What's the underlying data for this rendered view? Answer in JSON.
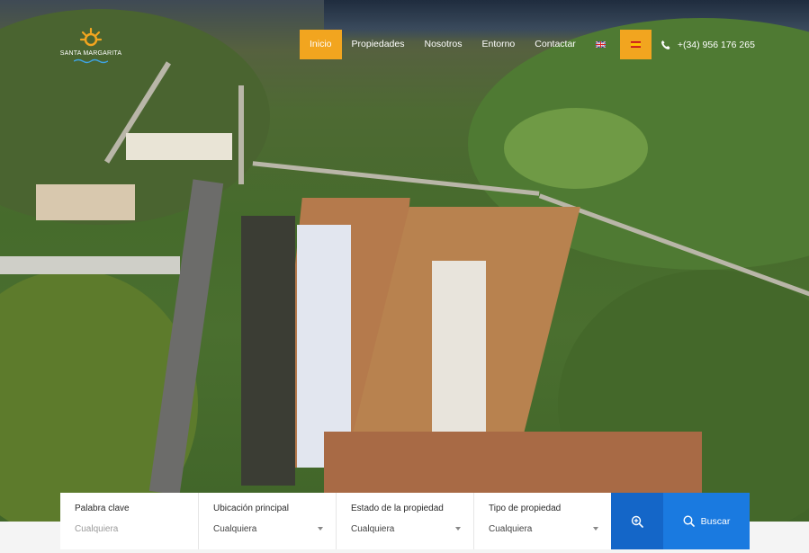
{
  "brand": {
    "name": "SANTA MARGARITA",
    "accent": "#f2a51f"
  },
  "nav": {
    "items": [
      {
        "label": "Inicio",
        "active": true
      },
      {
        "label": "Propiedades",
        "active": false
      },
      {
        "label": "Nosotros",
        "active": false
      },
      {
        "label": "Entorno",
        "active": false
      },
      {
        "label": "Contactar",
        "active": false
      }
    ],
    "languages": [
      {
        "icon": "uk-flag-icon",
        "active": false
      },
      {
        "icon": "spain-flag-icon",
        "active": true
      }
    ],
    "phone": {
      "icon": "phone-icon",
      "number": "+(34) 956 176 265"
    }
  },
  "search": {
    "fields": [
      {
        "label": "Palabra clave",
        "value": "Cualquiera",
        "placeholder": true
      },
      {
        "label": "Ubicación principal",
        "value": "Cualquiera",
        "placeholder": false
      },
      {
        "label": "Estado de la propiedad",
        "value": "Cualquiera",
        "placeholder": false
      },
      {
        "label": "Tipo de propiedad",
        "value": "Cualquiera",
        "placeholder": false
      }
    ],
    "advanced_icon": "zoom-in-icon",
    "submit": {
      "icon": "search-icon",
      "label": "Buscar"
    },
    "colors": {
      "advanced": "#1466c8",
      "submit": "#1a7ae0"
    }
  }
}
